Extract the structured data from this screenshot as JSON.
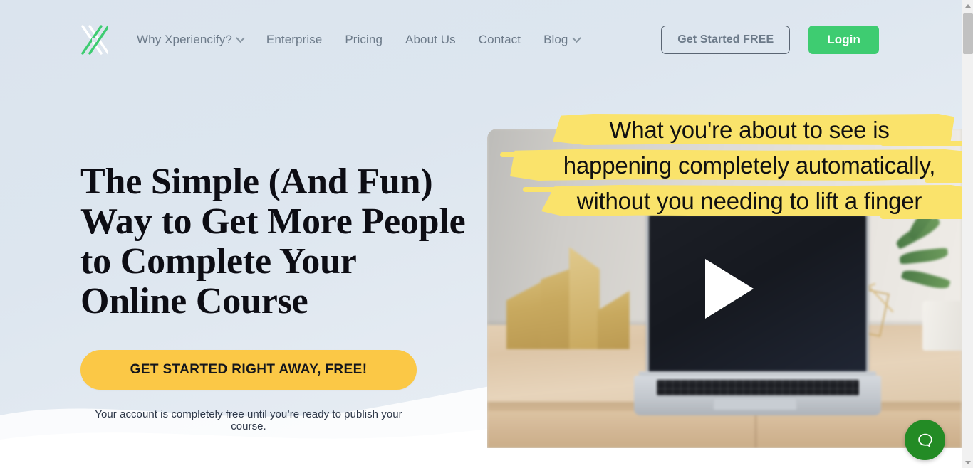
{
  "brand": {
    "logo_icon": "xperiencify-x-logo",
    "accent_green": "#3ecc71",
    "accent_yellow": "#fbc846",
    "marker_yellow": "#fae36b",
    "page_background": "#dbe4ee"
  },
  "header": {
    "nav": [
      {
        "label": "Why Xperiencify?",
        "has_dropdown": true
      },
      {
        "label": "Enterprise",
        "has_dropdown": false
      },
      {
        "label": "Pricing",
        "has_dropdown": false
      },
      {
        "label": "About Us",
        "has_dropdown": false
      },
      {
        "label": "Contact",
        "has_dropdown": false
      },
      {
        "label": "Blog",
        "has_dropdown": true
      }
    ],
    "get_started_label": "Get Started FREE",
    "login_label": "Login"
  },
  "hero": {
    "headline_lines": [
      "The Simple (And Fun)",
      "Way to Get More People",
      "to Complete Your",
      "Online Course"
    ],
    "cta_label": "GET STARTED RIGHT AWAY, FREE!",
    "subnote": "Your account is completely free until you’re ready to publish your course."
  },
  "video": {
    "caption_lines": [
      "What you're about to see is",
      "happening completely automatically,",
      "without you needing to lift a finger"
    ],
    "play_icon": "play-triangle-icon",
    "thumbnail_description": "laptop on wooden desk with gold magazine files and plant"
  },
  "help": {
    "icon": "chat-bubble-icon"
  },
  "scrollbar": {
    "up_icon": "scroll-up-arrow-icon",
    "down_icon": "scroll-down-arrow-icon"
  }
}
